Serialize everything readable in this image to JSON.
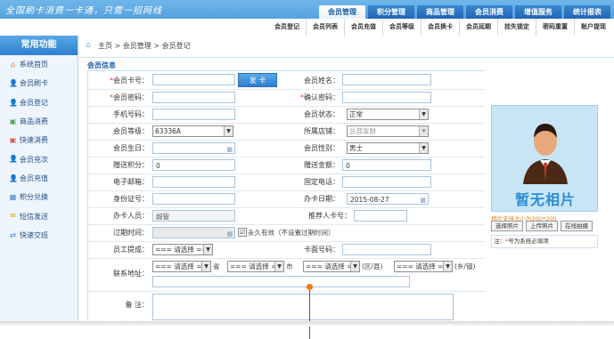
{
  "header": {
    "slogan": "全国刷卡消费一卡通，只需一招网线",
    "tabs": [
      "会员管理",
      "积分管理",
      "商品管理",
      "会员消费",
      "增值服务",
      "统计报表"
    ],
    "active_tab": 0
  },
  "subnav": [
    "会员登记",
    "会员列表",
    "会员充值",
    "会员等级",
    "会员换卡",
    "会员延期",
    "挂失锁定",
    "密码重置",
    "账户提现"
  ],
  "sidebar": {
    "title": "常用功能",
    "items": [
      {
        "label": "系统首页",
        "icon": "home-icon"
      },
      {
        "label": "会员刷卡",
        "icon": "user-card-icon"
      },
      {
        "label": "会员登记",
        "icon": "user-add-icon"
      },
      {
        "label": "商品消费",
        "icon": "shopping-icon"
      },
      {
        "label": "快速消费",
        "icon": "lightning-icon"
      },
      {
        "label": "会员充次",
        "icon": "user-recharge-icon"
      },
      {
        "label": "会员充值",
        "icon": "user-money-icon"
      },
      {
        "label": "积分兑换",
        "icon": "gift-icon"
      },
      {
        "label": "短信发送",
        "icon": "mail-icon"
      },
      {
        "label": "快速交班",
        "icon": "handover-icon"
      }
    ]
  },
  "breadcrumb": "主页 > 会员管理 > 会员登记",
  "section_title": "会员信息",
  "form": {
    "card_no": {
      "label": "会员卡号：",
      "required": "*",
      "value": ""
    },
    "issue_button": "发  卡",
    "name": {
      "label": "会员姓名：",
      "value": ""
    },
    "password": {
      "label": "会员密码：",
      "required": "*",
      "value": ""
    },
    "confirm_password": {
      "label": "确认密码：",
      "required": "*",
      "value": ""
    },
    "phone": {
      "label": "手机号码：",
      "value": ""
    },
    "status": {
      "label": "会员状态：",
      "value": "正常"
    },
    "level": {
      "label": "会员等级：",
      "value": "63336A"
    },
    "store": {
      "label": "所属店铺：",
      "value": "总部发财"
    },
    "birthday": {
      "label": "会员生日：",
      "value": ""
    },
    "gender": {
      "label": "会员性别：",
      "value": "男士"
    },
    "gift_points": {
      "label": "赠送积分：",
      "value": "0"
    },
    "gift_amount": {
      "label": "赠送金额：",
      "value": "0"
    },
    "email": {
      "label": "电子邮箱：",
      "value": ""
    },
    "landline": {
      "label": "固定电话：",
      "value": ""
    },
    "id_no": {
      "label": "身份证号：",
      "value": ""
    },
    "issue_date": {
      "label": "办卡日期：",
      "value": "2015-08-27"
    },
    "operator": {
      "label": "办卡人员：",
      "value": "超管"
    },
    "referrer": {
      "label": "推荐人卡号：",
      "value": ""
    },
    "expiry": {
      "label": "过期时间：",
      "value": ""
    },
    "permanent": {
      "checkbox": "☑",
      "label": "永久有效（不设置过期时间）"
    },
    "commission": {
      "label": "员工提成：",
      "value": "=== 请选择 ==="
    },
    "card_face": {
      "label": "卡面号码：",
      "value": ""
    },
    "address": {
      "label": "联系地址：",
      "province": "=== 请选择 ===",
      "province_suffix": "省",
      "city": "=== 请选择 ===",
      "city_suffix": "市",
      "district": "=== 请选择 ===",
      "district_suffix": "(区/县)",
      "town": "=== 请选择 ===",
      "town_suffix": "(乡/镇)",
      "detail": ""
    },
    "remark": {
      "label": "备  注：",
      "value": ""
    }
  },
  "photo": {
    "no_photo_text": "暂无相片",
    "size_note": "相片支持大小为200*200",
    "buttons": [
      "选择照片",
      "上传照片",
      "在线拍摄"
    ],
    "required_note_prefix": "注：",
    "required_mark": "*",
    "required_note": "号为系统必填项"
  }
}
